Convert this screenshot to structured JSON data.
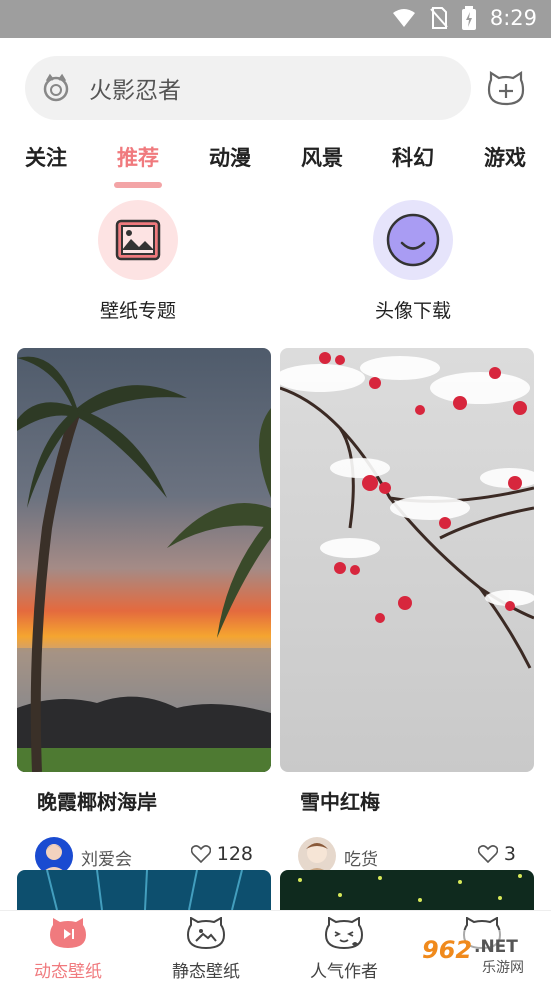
{
  "status_bar": {
    "time": "8:29"
  },
  "search": {
    "placeholder": "火影忍者"
  },
  "tabs": [
    {
      "label": "关注"
    },
    {
      "label": "推荐",
      "active": true
    },
    {
      "label": "动漫"
    },
    {
      "label": "风景"
    },
    {
      "label": "科幻"
    },
    {
      "label": "游戏"
    }
  ],
  "quick_links": [
    {
      "label": "壁纸专题",
      "icon": "wallpaper-topic-icon"
    },
    {
      "label": "头像下载",
      "icon": "avatar-download-icon"
    }
  ],
  "cards": [
    {
      "title": "晚霞椰树海岸",
      "author": "刘爱会",
      "likes": "128"
    },
    {
      "title": "雪中红梅",
      "author": "吃货",
      "likes": "3"
    }
  ],
  "bottom_nav": [
    {
      "label": "动态壁纸",
      "active": true
    },
    {
      "label": "静态壁纸"
    },
    {
      "label": "人气作者"
    },
    {
      "label": ""
    }
  ],
  "watermark": {
    "text": "962.NET",
    "subtext": "乐游网"
  },
  "colors": {
    "accent": "#f07a7e",
    "status_bar": "#9e9e9e"
  }
}
